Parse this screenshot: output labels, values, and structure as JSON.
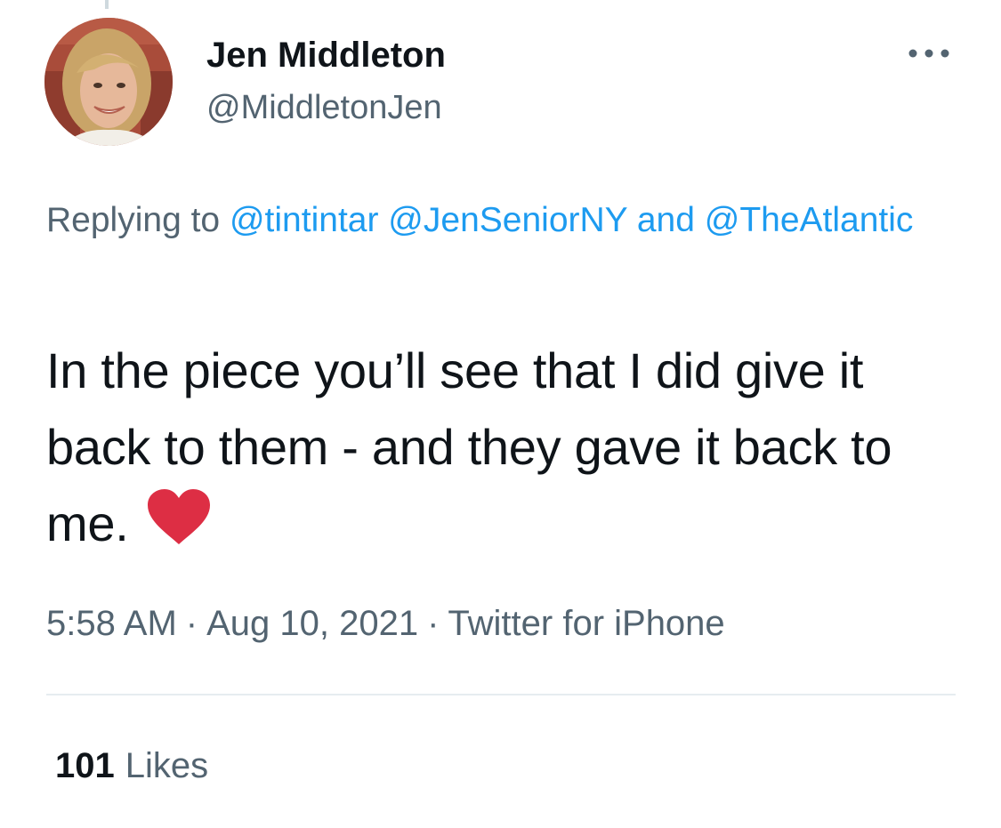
{
  "tweet": {
    "author": {
      "display_name": "Jen Middleton",
      "handle": "@MiddletonJen",
      "avatar_icon": "profile-photo"
    },
    "more_icon": "more-horizontal-icon",
    "reply": {
      "prefix": "Replying to",
      "mentions": [
        "@tintintar",
        "@JenSeniorNY",
        "@TheAtlantic"
      ],
      "joiner": "and"
    },
    "text": "In the piece you’ll see that I did give it back to them - and they gave it back to me.",
    "emoji_icon": "red-heart-emoji",
    "meta": {
      "time": "5:58 AM",
      "separator": "·",
      "date": "Aug 10, 2021",
      "source": "Twitter for iPhone"
    },
    "stats": {
      "likes_count": "101",
      "likes_label": "Likes"
    }
  },
  "colors": {
    "link": "#1d9bf0",
    "secondary_text": "#536471",
    "primary_text": "#0f1419",
    "heart": "#dd2e44",
    "divider": "#e6ecf0"
  }
}
